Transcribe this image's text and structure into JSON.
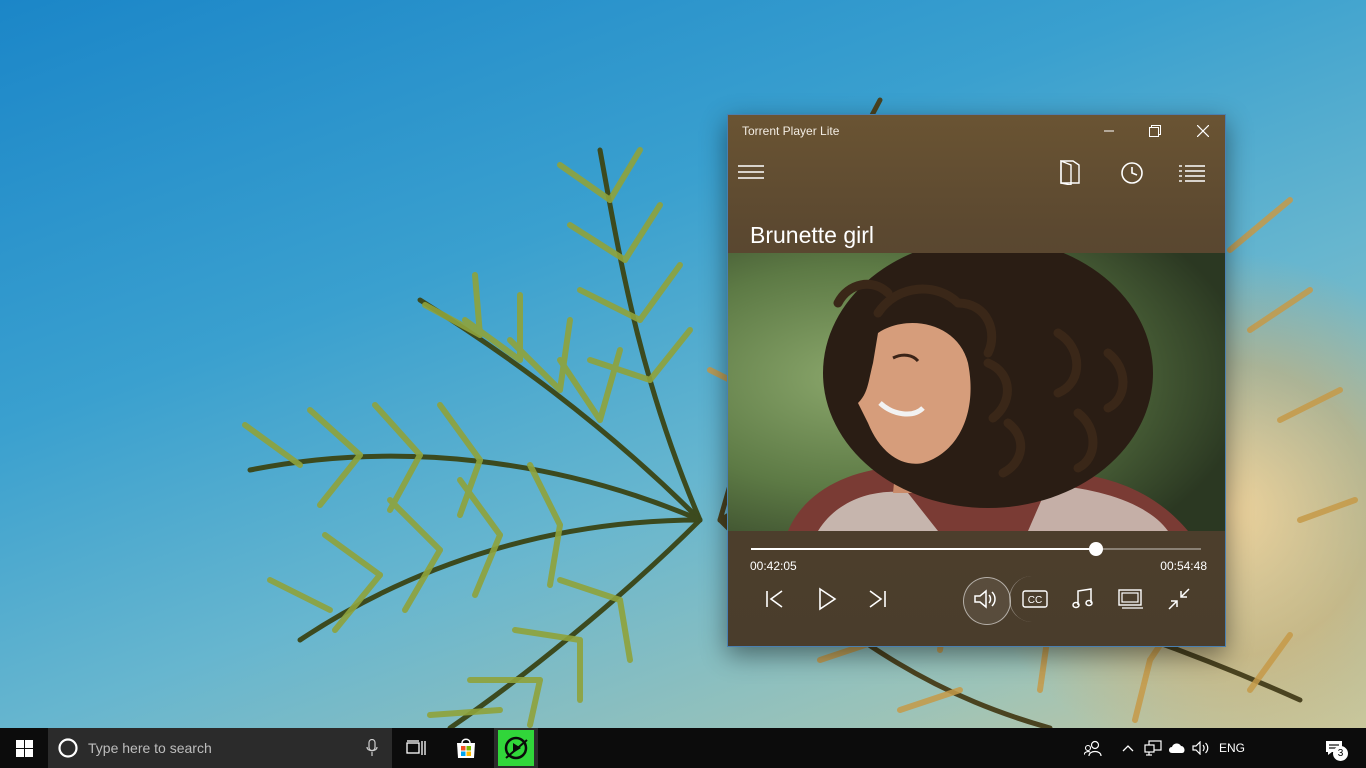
{
  "window": {
    "title": "Torrent Player Lite",
    "video_title": "Brunette girl",
    "toolbar_icons": [
      "hamburger-menu-icon",
      "open-file-icon",
      "history-icon",
      "playlist-icon"
    ]
  },
  "playback": {
    "current_time": "00:42:05",
    "total_time": "00:54:48",
    "progress_fraction": 0.767
  },
  "controls": [
    "previous-icon",
    "play-icon",
    "next-icon",
    "volume-icon",
    "closed-captions-icon",
    "audio-track-icon",
    "aspect-ratio-icon",
    "compact-mode-icon"
  ],
  "controls_labels": {
    "cc": "CC"
  },
  "taskbar": {
    "search_placeholder": "Type here to search",
    "language": "ENG",
    "notification_count": "3",
    "pinned": [
      "task-view-icon",
      "store-icon",
      "torrent-player-icon"
    ]
  },
  "colors": {
    "window_border": "#4a7fb0",
    "taskbar": "#0c0c0c",
    "active_app": "#31d63a"
  }
}
